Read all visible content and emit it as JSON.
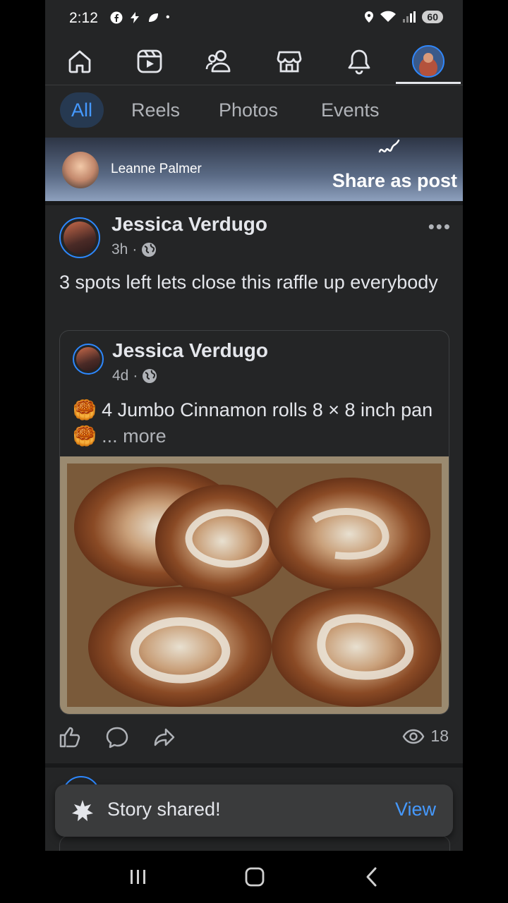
{
  "status_bar": {
    "time": "2:12",
    "battery": "60",
    "dot": "•"
  },
  "nav": {
    "items": [
      {
        "name": "home"
      },
      {
        "name": "reels"
      },
      {
        "name": "friends"
      },
      {
        "name": "marketplace"
      },
      {
        "name": "notifications"
      },
      {
        "name": "profile"
      }
    ],
    "active": "profile"
  },
  "filters": {
    "tabs": [
      "All",
      "Reels",
      "Photos",
      "Events"
    ],
    "active": "All"
  },
  "story": {
    "name": "Leanne Palmer",
    "action": "Share as post"
  },
  "post": {
    "author": "Jessica Verdugo",
    "time": "3h",
    "separator": "·",
    "text": "3 spots left lets close this raffle up everybody",
    "shared": {
      "author": "Jessica Verdugo",
      "time": "4d",
      "text": "🥮 4 Jumbo Cinnamon rolls 8 × 8 inch pan 🥮",
      "more": "... more"
    },
    "views": "18"
  },
  "toast": {
    "text": "Story shared!",
    "action": "View"
  },
  "colors": {
    "accent": "#4599ff",
    "background": "#242526",
    "chip_active": "#263951"
  }
}
